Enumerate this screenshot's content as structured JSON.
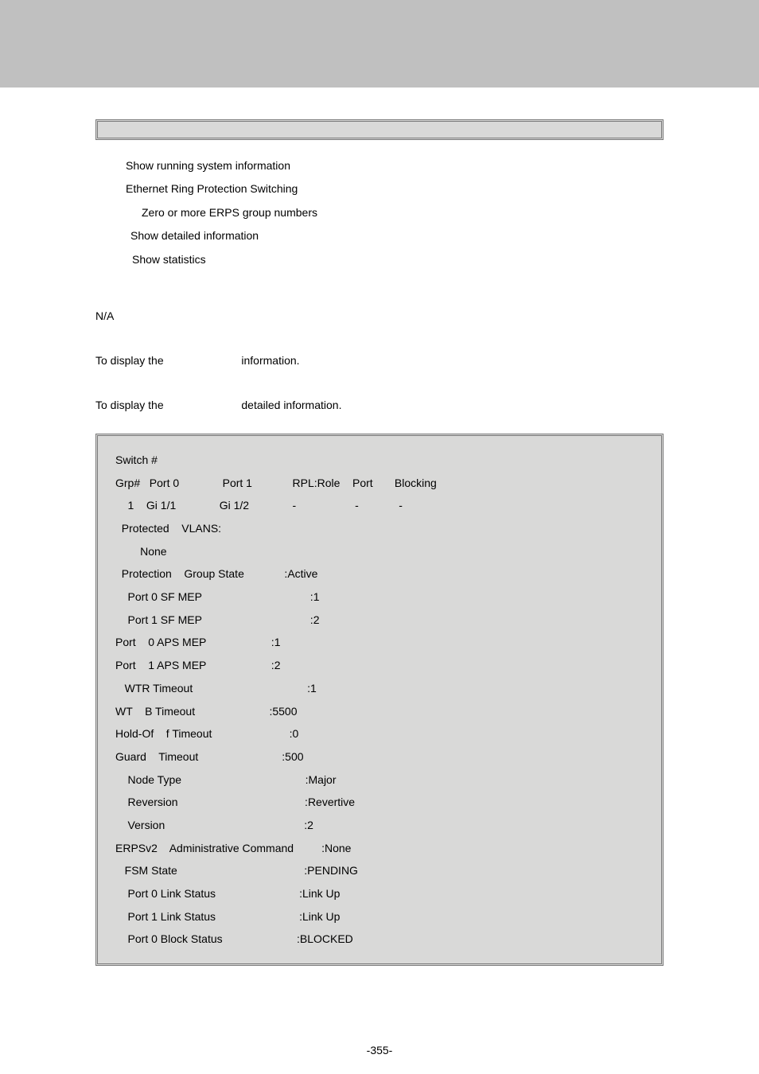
{
  "list": {
    "l1": "Show running system information",
    "l2": "Ethernet Ring Protection Switching",
    "l3": "Zero or more ERPS group numbers",
    "l4": "Show detailed information",
    "l5": "Show statistics"
  },
  "na": "N/A",
  "desc1a": "To display the ",
  "desc1b": " information.",
  "desc2a": "To display the ",
  "desc2b": " detailed information.",
  "code": {
    "c01": "Switch #",
    "c02": "Grp#   Port 0              Port 1             RPL:Role    Port       Blocking",
    "c03": "    1    Gi 1/1              Gi 1/2              -                   -             -",
    "c04": "  Protected    VLANS:",
    "c05": "        None",
    "c06": "  Protection    Group State             :Active",
    "c07": "    Port 0 SF MEP                                   :1",
    "c08": "    Port 1 SF MEP                                   :2",
    "c09": "Port    0 APS MEP                     :1",
    "c10": "Port    1 APS MEP                     :2",
    "c11": "   WTR Timeout                                     :1",
    "c12": "WT    B Timeout                        :5500",
    "c13": "Hold-Of    f Timeout                         :0",
    "c14": "Guard    Timeout                           :500",
    "c15": "    Node Type                                        :Major",
    "c16": "    Reversion                                         :Revertive",
    "c17": "    Version                                             :2",
    "c18": "ERPSv2    Administrative Command         :None",
    "c19": "",
    "c20": "   FSM State                                         :PENDING",
    "c21": "    Port 0 Link Status                           :Link Up",
    "c22": "    Port 1 Link Status                           :Link Up",
    "c23": "    Port 0 Block Status                        :BLOCKED"
  },
  "pagenum": "-355-"
}
